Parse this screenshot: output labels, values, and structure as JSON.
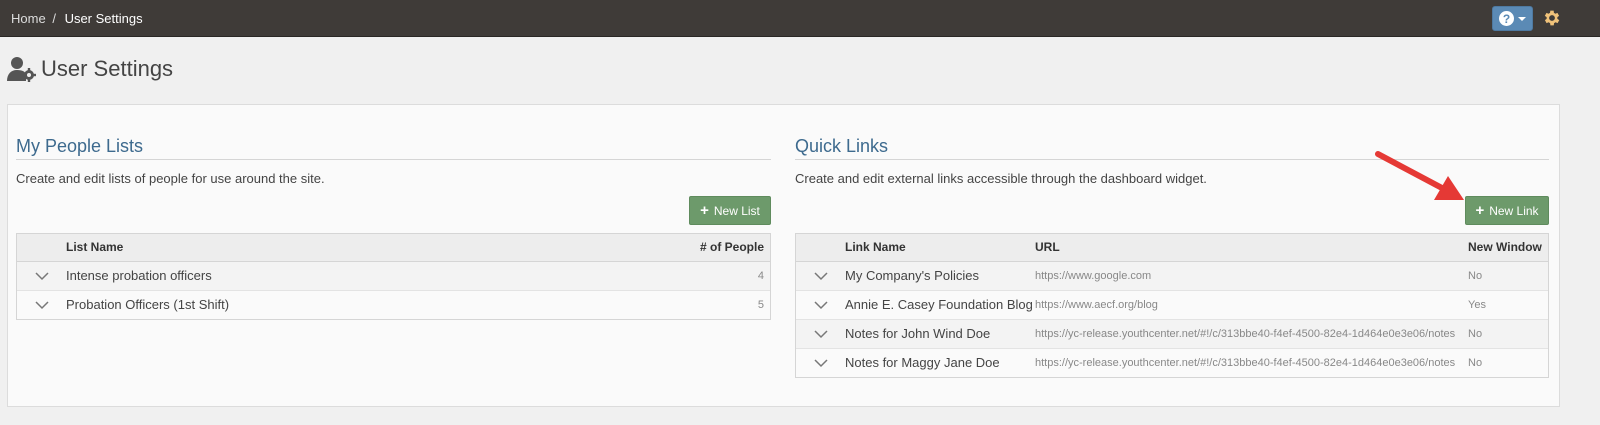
{
  "breadcrumb": {
    "home": "Home",
    "separator": "/",
    "current": "User Settings"
  },
  "header": {
    "help_icon_glyph": "?",
    "title": "User Settings"
  },
  "people_lists": {
    "title": "My People Lists",
    "description": "Create and edit lists of people for use around the site.",
    "new_button": "New List",
    "columns": {
      "name": "List Name",
      "count": "# of People"
    },
    "rows": [
      {
        "name": "Intense probation officers",
        "count": "4"
      },
      {
        "name": "Probation Officers (1st Shift)",
        "count": "5"
      }
    ]
  },
  "quick_links": {
    "title": "Quick Links",
    "description": "Create and edit external links accessible through the dashboard widget.",
    "new_button": "New Link",
    "columns": {
      "name": "Link Name",
      "url": "URL",
      "new_window": "New Window"
    },
    "rows": [
      {
        "name": "My Company's Policies",
        "url": "https://www.google.com",
        "new_window": "No"
      },
      {
        "name": "Annie E. Casey Foundation Blog",
        "url": "https://www.aecf.org/blog",
        "new_window": "Yes"
      },
      {
        "name": "Notes for John Wind Doe",
        "url": "https://yc-release.youthcenter.net/#!/c/313bbe40-f4ef-4500-82e4-1d464e0e3e06/notes",
        "new_window": "No"
      },
      {
        "name": "Notes for Maggy Jane Doe",
        "url": "https://yc-release.youthcenter.net/#!/c/313bbe40-f4ef-4500-82e4-1d464e0e3e06/notes",
        "new_window": "No"
      }
    ]
  },
  "colors": {
    "topbar": "#3f3b38",
    "accent_blue": "#3d6a8e",
    "button_green": "#6d9a6b",
    "help_blue": "#5b8ab5",
    "arrow_red": "#e53935",
    "gear_orange": "#f0c27a"
  },
  "icons": {
    "help": "help-icon",
    "settings": "gear-icon",
    "user_settings": "user-gear-icon",
    "expand": "chevron-down-icon",
    "add": "plus-icon"
  }
}
